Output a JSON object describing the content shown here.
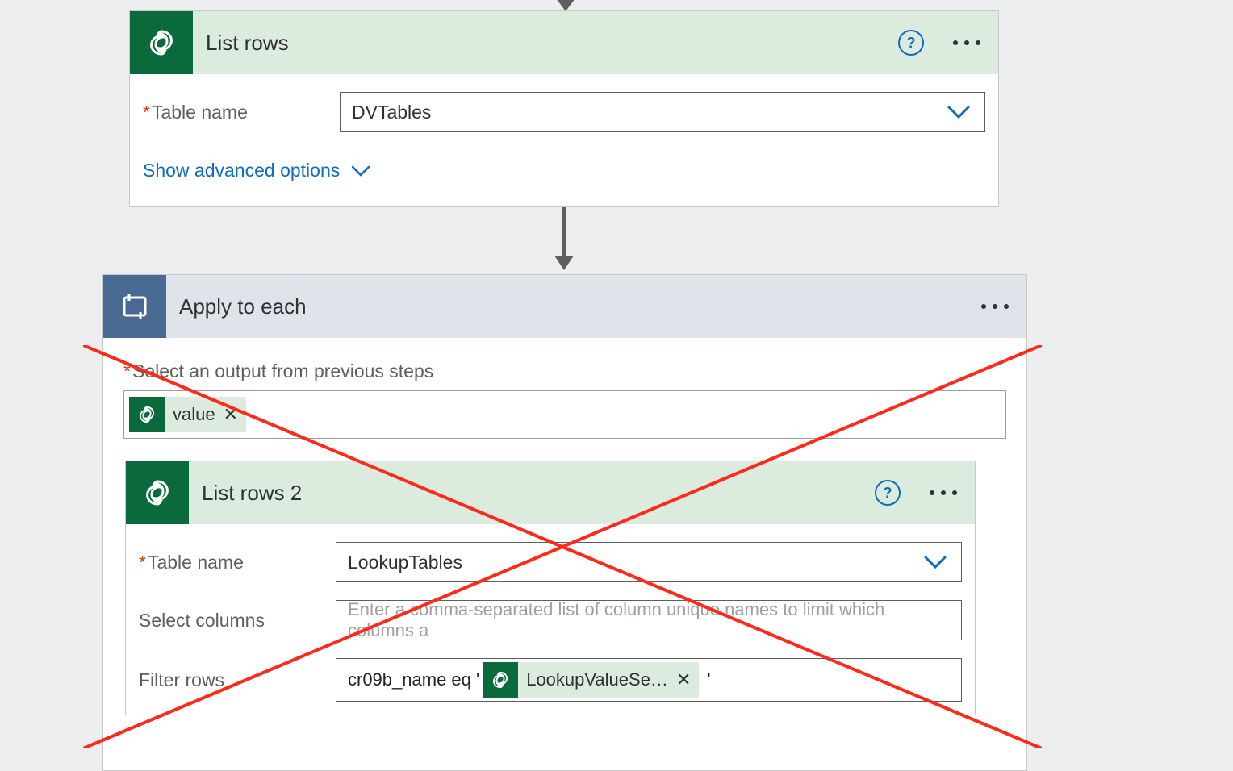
{
  "listRows1": {
    "title": "List rows",
    "tableNameLabel": "Table name",
    "tableNameValue": "DVTables",
    "advancedOptions": "Show advanced options"
  },
  "applyToEach": {
    "title": "Apply to each",
    "selectOutputLabel": "Select an output from previous steps",
    "token": {
      "label": "value"
    }
  },
  "listRows2": {
    "title": "List rows 2",
    "tableNameLabel": "Table name",
    "tableNameValue": "LookupTables",
    "selectColumnsLabel": "Select columns",
    "selectColumnsPlaceholder": "Enter a comma-separated list of column unique names to limit which columns a",
    "filterRowsLabel": "Filter rows",
    "filterRowsPrefix": "cr09b_name eq '",
    "filterRowsToken": "LookupValueSe…",
    "filterRowsSuffix": "'"
  }
}
